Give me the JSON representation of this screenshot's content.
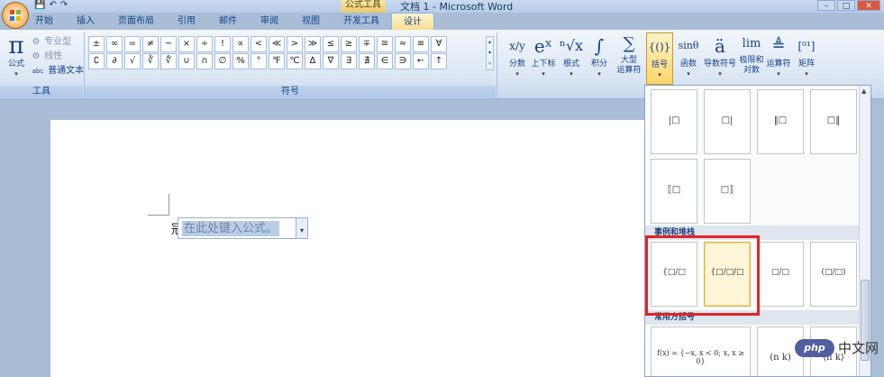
{
  "window": {
    "title": "文档 1 - Microsoft Word",
    "context_title": "公式工具",
    "minimize": "–",
    "maximize": "□",
    "close": "✕"
  },
  "qat": [
    "💾",
    "↶",
    "↷"
  ],
  "tabs": [
    "开始",
    "插入",
    "页面布局",
    "引用",
    "邮件",
    "审阅",
    "视图",
    "开发工具",
    "设计"
  ],
  "active_tab": "设计",
  "tools_group": {
    "label": "工具",
    "equation_label": "公式",
    "equation_glyph": "π",
    "options": [
      "专业型",
      "线性",
      "普通文本"
    ],
    "option_icons": [
      "⚙",
      "⚙",
      "abc"
    ]
  },
  "symbols_group": {
    "label": "符号",
    "row1": [
      "±",
      "∞",
      "=",
      "≠",
      "~",
      "×",
      "÷",
      "!",
      "∝",
      "<",
      "≪",
      ">",
      "≫",
      "≤",
      "≥",
      "∓",
      "≅",
      "≈",
      "≡",
      "∀"
    ],
    "row2": [
      "∁",
      "∂",
      "√",
      "∛",
      "∜",
      "∪",
      "∩",
      "∅",
      "%",
      "°",
      "℉",
      "℃",
      "∆",
      "∇",
      "∃",
      "∄",
      "∈",
      "∋",
      "←",
      "↑"
    ]
  },
  "structures": [
    {
      "label": "分数",
      "glyph": "x/y"
    },
    {
      "label": "上下标",
      "glyph": "eˣ"
    },
    {
      "label": "根式",
      "glyph": "ⁿ√x"
    },
    {
      "label": "积分",
      "glyph": "∫"
    },
    {
      "label": "大型\n运算符",
      "glyph": "∑"
    },
    {
      "label": "括号",
      "glyph": "{()}"
    },
    {
      "label": "函数",
      "glyph": "sinθ"
    },
    {
      "label": "导数符号",
      "glyph": "ä"
    },
    {
      "label": "极限和\n对数",
      "glyph": "lim"
    },
    {
      "label": "运算符",
      "glyph": "≜"
    },
    {
      "label": "矩阵",
      "glyph": "[⁰¹]"
    }
  ],
  "document": {
    "prefix": "冠",
    "equation_placeholder": "在此处键入公式。"
  },
  "gallery": {
    "row1": [
      "|□",
      "□|",
      "‖□",
      "□‖"
    ],
    "row2": [
      "⟦□",
      "□⟧"
    ],
    "section_cases": "事例和堆栈",
    "cases": [
      "{□/□",
      "{□/□/□",
      "□/□",
      "(□/□)"
    ],
    "section_common": "常用方括号",
    "common": [
      "f(x) = {−x, x < 0; x, x ≥ 0}",
      "(n k)",
      "⟨n k⟩"
    ],
    "scroll_up": "▲"
  },
  "watermark": {
    "logo": "php",
    "text": "中文网"
  }
}
